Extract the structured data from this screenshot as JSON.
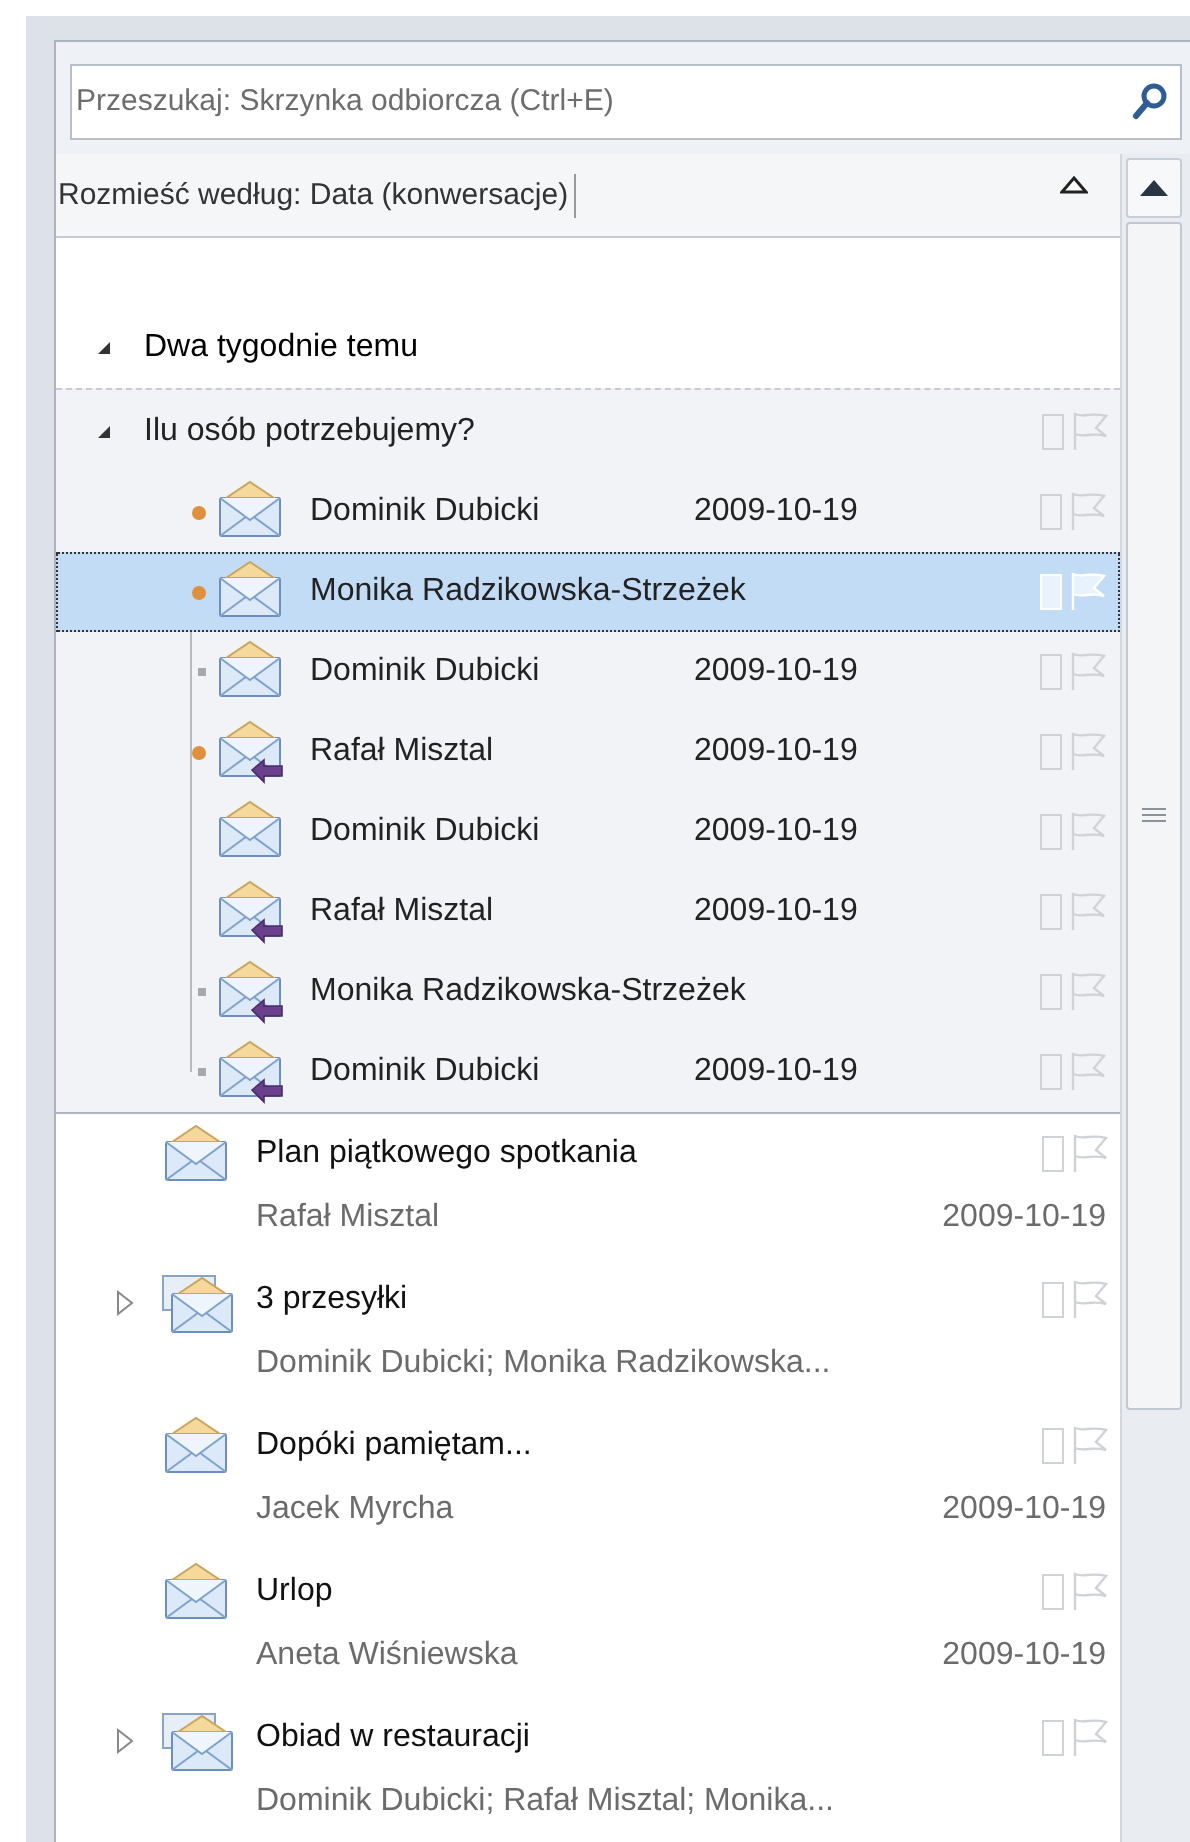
{
  "search": {
    "placeholder": "Przeszukaj: Skrzynka odbiorcza (Ctrl+E)"
  },
  "sort": {
    "label": "Rozmieść według: Data (konwersacje)"
  },
  "group": {
    "label": "Dwa tygodnie temu",
    "expanded": true
  },
  "conversation": {
    "subject": "Ilu osób potrzebujemy?",
    "expanded": true,
    "messages": [
      {
        "sender": "Dominik Dubicki",
        "date": "2009-10-19",
        "kind": "mail",
        "unread_dot": true,
        "thread_node": false,
        "selected": false
      },
      {
        "sender": "Monika Radzikowska-Strzeżek",
        "kind": "mail",
        "unread_dot": true,
        "thread_node": false,
        "selected": true
      },
      {
        "sender": "Dominik Dubicki",
        "date": "2009-10-19",
        "kind": "mail",
        "unread_dot": false,
        "thread_node": true,
        "selected": false
      },
      {
        "sender": "Rafał Misztal",
        "date": "2009-10-19",
        "kind": "reply",
        "unread_dot": true,
        "thread_node": false,
        "selected": false
      },
      {
        "sender": "Dominik Dubicki",
        "date": "2009-10-19",
        "kind": "mail",
        "unread_dot": false,
        "thread_node": false,
        "selected": false
      },
      {
        "sender": "Rafał Misztal",
        "date": "2009-10-19",
        "kind": "reply",
        "unread_dot": false,
        "thread_node": false,
        "selected": false
      },
      {
        "sender": "Monika Radzikowska-Strzeżek",
        "kind": "reply",
        "unread_dot": false,
        "thread_node": true,
        "selected": false
      },
      {
        "sender": "Dominik Dubicki",
        "date": "2009-10-19",
        "kind": "reply",
        "unread_dot": false,
        "thread_node": true,
        "selected": false
      }
    ]
  },
  "items": [
    {
      "subject": "Plan piątkowego spotkania",
      "from": "Rafał Misztal",
      "date": "2009-10-19",
      "kind": "message"
    },
    {
      "subject": "3 przesyłki",
      "from": "Dominik Dubicki; Monika Radzikowska...",
      "kind": "conversation",
      "expanded": false
    },
    {
      "subject": "Dopóki pamiętam...",
      "from": "Jacek Myrcha",
      "date": "2009-10-19",
      "kind": "message"
    },
    {
      "subject": "Urlop",
      "from": "Aneta Wiśniewska",
      "date": "2009-10-19",
      "kind": "message"
    },
    {
      "subject": "Obiad w restauracji",
      "from": "Dominik Dubicki; Rafał Misztal; Monika...",
      "kind": "conversation",
      "expanded": false
    }
  ]
}
